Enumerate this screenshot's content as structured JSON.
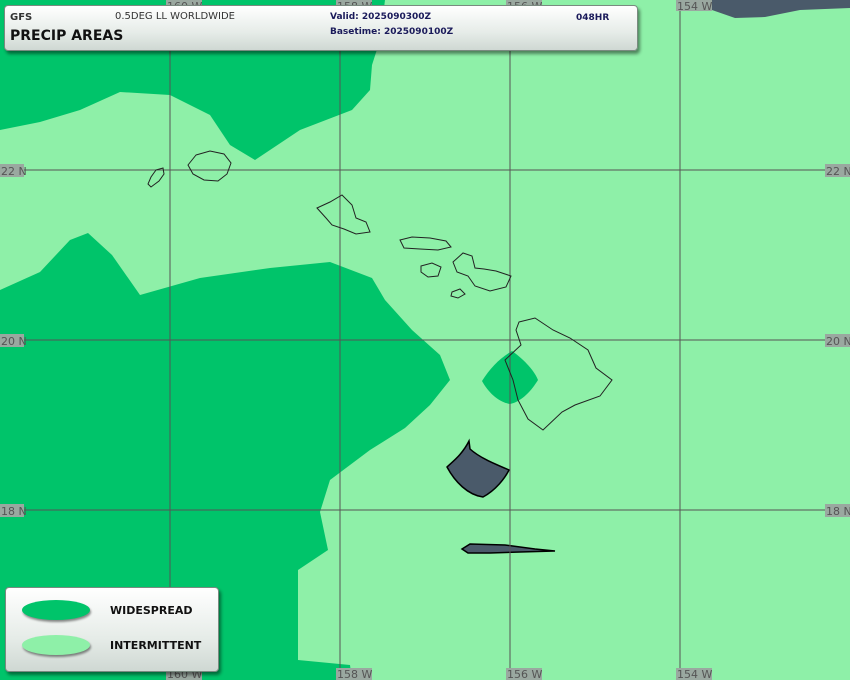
{
  "header": {
    "model": "GFS",
    "grid": "0.5DEG LL WORLDWIDE",
    "product": "PRECIP AREAS",
    "valid": "Valid: 2025090300Z",
    "basetime": "Basetime: 2025090100Z",
    "forecast_hour": "048HR"
  },
  "legend": {
    "items": [
      {
        "label": "WIDESPREAD",
        "color": "#00c46a"
      },
      {
        "label": "INTERMITTENT",
        "color": "#8ef0a8"
      }
    ]
  },
  "colors": {
    "widespread": "#00c46a",
    "intermittent": "#8ef0a8",
    "convective": "#4a5a6a",
    "gridline": "#555555",
    "coastline": "#222222"
  },
  "grid_labels": {
    "lat": [
      "22 N",
      "20 N",
      "18 N"
    ],
    "lon": [
      "160 W",
      "158 W",
      "156 W",
      "154 W"
    ]
  }
}
